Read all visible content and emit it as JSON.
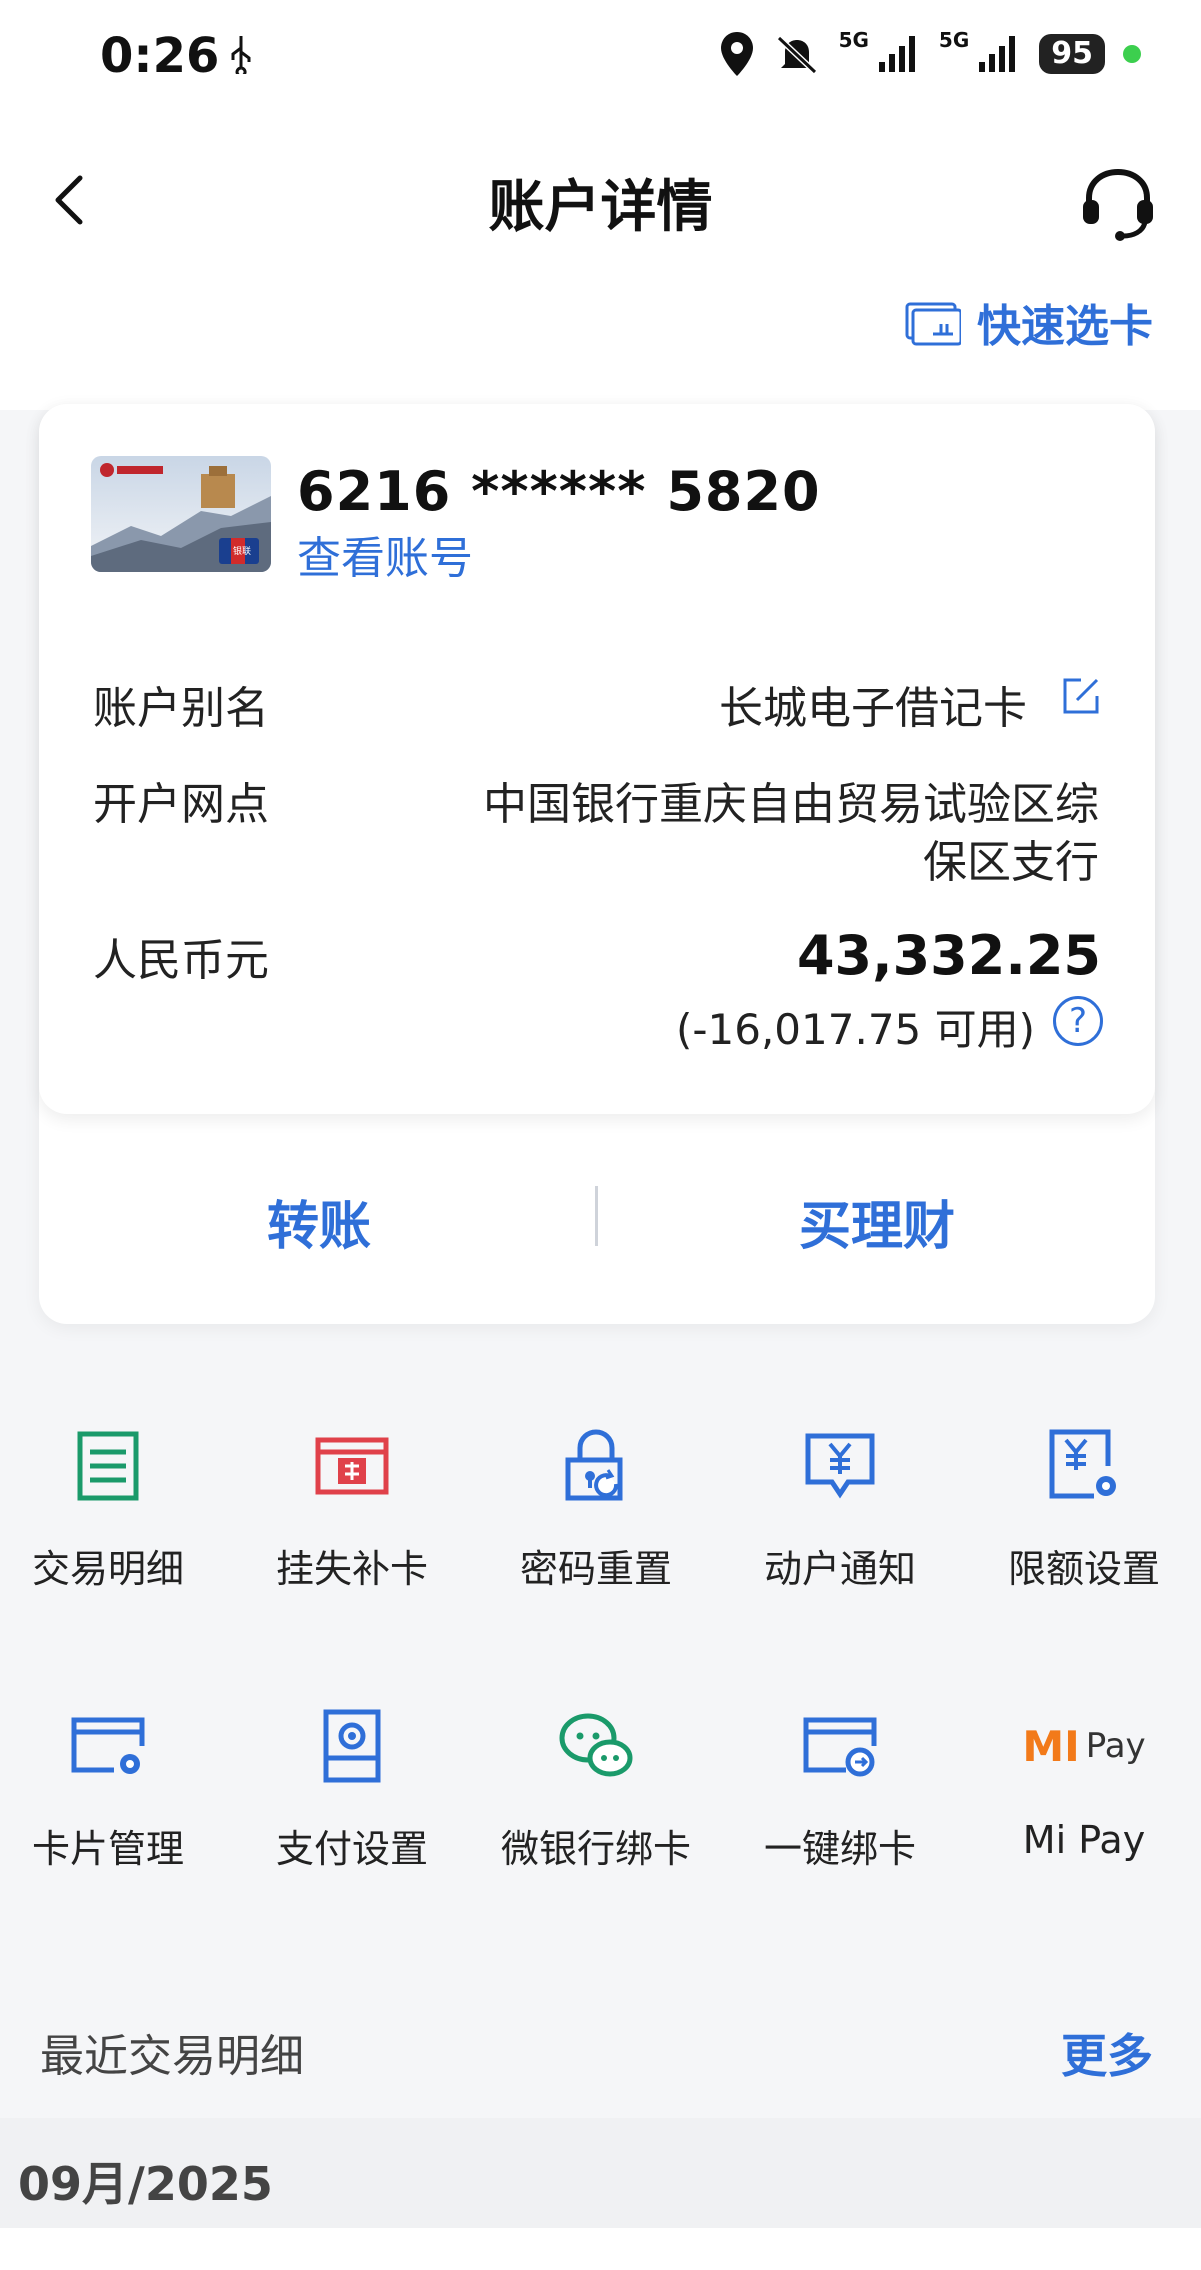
{
  "status": {
    "time": "0:26",
    "net1": "5G",
    "net2": "5G",
    "battery": "95"
  },
  "nav": {
    "title": "账户详情",
    "back_icon": "chevron-left-icon",
    "service_icon": "headset-icon"
  },
  "quick_select": {
    "label": "快速选卡",
    "icon": "card-list-icon"
  },
  "card": {
    "number": "6216 ****** 5820",
    "view_account": "查看账号",
    "alias_label": "账户别名",
    "alias_value": "长城电子借记卡",
    "branch_label": "开户网点",
    "branch_line1": "中国银行重庆自由贸易试验区综",
    "branch_line2": "保区支行",
    "currency_label": "人民币元",
    "balance": "43,332.25",
    "available": "(-16,017.75 可用)",
    "help": "?"
  },
  "actions": {
    "transfer": "转账",
    "wealth": "买理财"
  },
  "grid": [
    {
      "label": "交易明细",
      "icon": "transaction-list-icon",
      "color": "#1a9a6a"
    },
    {
      "label": "挂失补卡",
      "icon": "card-replace-icon",
      "color": "#e0414a"
    },
    {
      "label": "密码重置",
      "icon": "lock-reset-icon",
      "color": "#2f6fd8"
    },
    {
      "label": "动户通知",
      "icon": "notification-icon",
      "color": "#2f6fd8"
    },
    {
      "label": "限额设置",
      "icon": "limit-settings-icon",
      "color": "#2f6fd8"
    },
    {
      "label": "卡片管理",
      "icon": "card-gear-icon",
      "color": "#2f6fd8"
    },
    {
      "label": "支付设置",
      "icon": "payment-settings-icon",
      "color": "#2f6fd8"
    },
    {
      "label": "微银行绑卡",
      "icon": "wechat-icon",
      "color": "#1a9a6a"
    },
    {
      "label": "一键绑卡",
      "icon": "card-link-icon",
      "color": "#2f6fd8"
    },
    {
      "label": "Mi Pay",
      "icon": "mipay-logo",
      "color": "#f27a1a"
    }
  ],
  "mipay_logo": {
    "mi": "MI",
    "pay": "Pay"
  },
  "card_logo": {
    "unionpay": "银联"
  },
  "recent": {
    "title": "最近交易明细",
    "more": "更多",
    "month": "09月/2025"
  }
}
